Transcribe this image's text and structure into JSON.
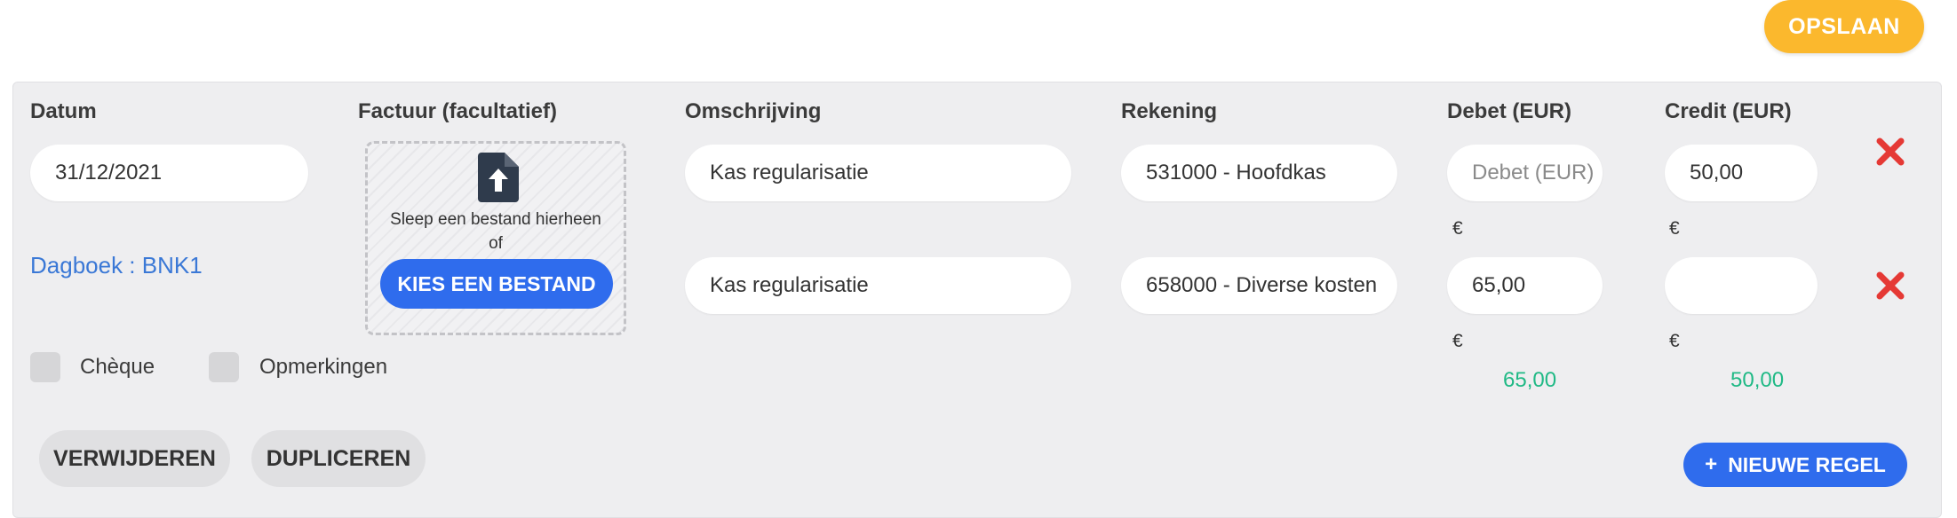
{
  "toolbar": {
    "save_label": "OPSLAAN"
  },
  "columns": {
    "date": "Datum",
    "invoice": "Factuur (facultatief)",
    "description": "Omschrijving",
    "account": "Rekening",
    "debit": "Debet (EUR)",
    "credit": "Credit (EUR)"
  },
  "date_value": "31/12/2021",
  "journal": "Dagboek : BNK1",
  "dropzone": {
    "text": "Sleep een bestand hierheen of",
    "button": "KIES EEN BESTAND"
  },
  "checkboxes": {
    "cheque": "Chèque",
    "remarks": "Opmerkingen"
  },
  "lines": [
    {
      "description": "Kas regularisatie",
      "account": "531000 - Hoofdkas",
      "debit": "",
      "debit_placeholder": "Debet (EUR)",
      "credit": "50,00",
      "currency": "€"
    },
    {
      "description": "Kas regularisatie",
      "account": "658000 - Diverse kosten",
      "debit": "65,00",
      "credit": "",
      "currency": "€"
    }
  ],
  "totals": {
    "debit": "65,00",
    "credit": "50,00"
  },
  "actions": {
    "delete": "VERWIJDEREN",
    "duplicate": "DUPLICEREN",
    "new_line": "NIEUWE REGEL",
    "new_line_icon": "+"
  },
  "colors": {
    "save": "#fbb82d",
    "primary": "#2f6ced",
    "total": "#1fb985",
    "remove": "#e53935",
    "journal_link": "#3a78d6"
  }
}
